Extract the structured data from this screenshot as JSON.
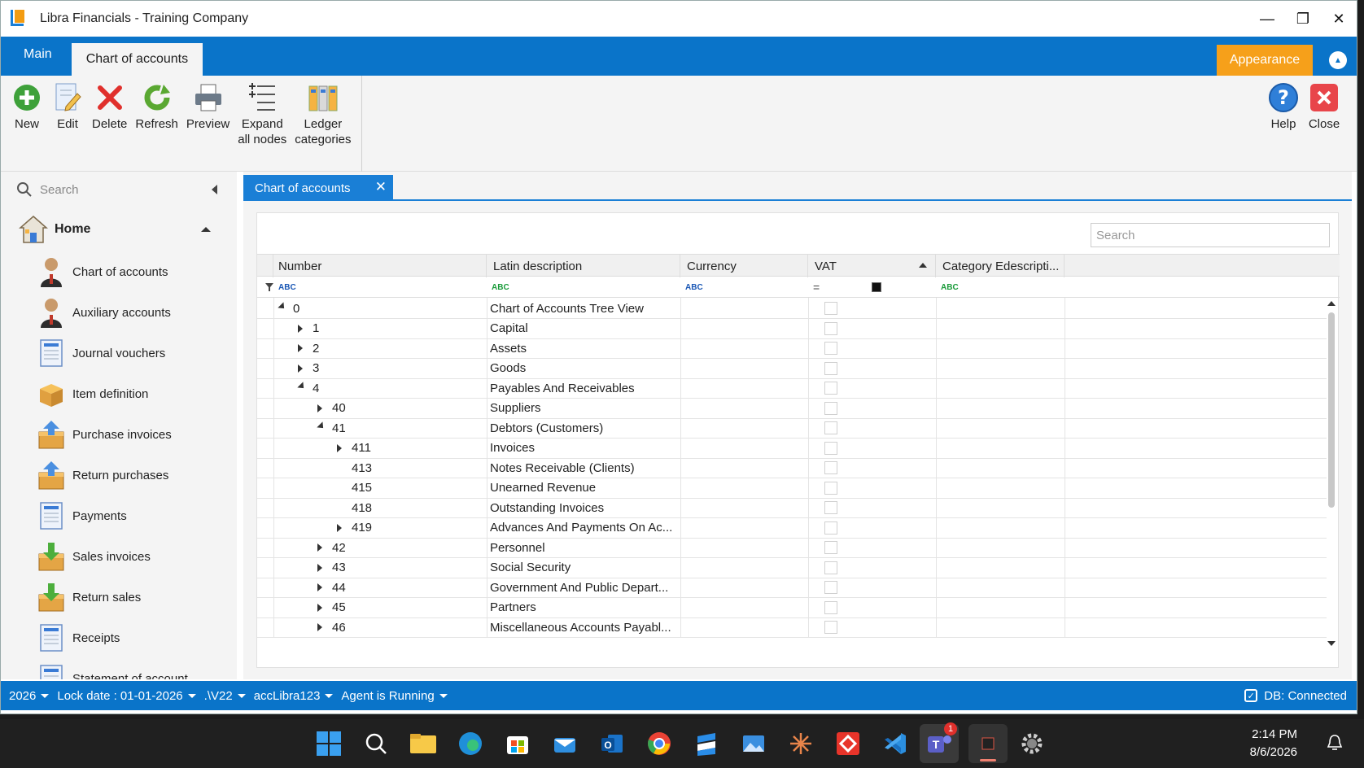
{
  "window": {
    "title": "Libra Financials - Training Company"
  },
  "ribbon": {
    "tabs": [
      {
        "label": "Main"
      },
      {
        "label": "Chart of accounts"
      }
    ],
    "appearance": "Appearance",
    "buttons": [
      {
        "label": "New",
        "icon": "plus-circle-icon"
      },
      {
        "label": "Edit",
        "icon": "edit-document-icon"
      },
      {
        "label": "Delete",
        "icon": "delete-x-icon"
      },
      {
        "label": "Refresh",
        "icon": "refresh-icon"
      },
      {
        "label": "Preview",
        "icon": "printer-icon"
      },
      {
        "label": "Expand all nodes",
        "line1": "Expand",
        "line2": "all nodes",
        "icon": "expand-nodes-icon"
      },
      {
        "label": "Ledger categories",
        "line1": "Ledger",
        "line2": "categories",
        "icon": "ledger-icon"
      }
    ],
    "right_buttons": [
      {
        "label": "Help",
        "icon": "help-icon"
      },
      {
        "label": "Close",
        "icon": "close-icon"
      }
    ]
  },
  "sidebar": {
    "search_placeholder": "Search",
    "home": "Home",
    "items": [
      {
        "label": "Chart of accounts",
        "icon": "person-icon"
      },
      {
        "label": "Auxiliary accounts",
        "icon": "person-icon"
      },
      {
        "label": "Journal vouchers",
        "icon": "document-icon"
      },
      {
        "label": "Item definition",
        "icon": "boxes-icon"
      },
      {
        "label": "Purchase invoices",
        "icon": "box-up-icon"
      },
      {
        "label": "Return purchases",
        "icon": "box-up-icon"
      },
      {
        "label": "Payments",
        "icon": "document-icon"
      },
      {
        "label": "Sales invoices",
        "icon": "box-down-icon"
      },
      {
        "label": "Return sales",
        "icon": "box-down-icon"
      },
      {
        "label": "Receipts",
        "icon": "document-icon"
      },
      {
        "label": "Statement of account",
        "icon": "document-icon"
      }
    ]
  },
  "document_tab": {
    "label": "Chart of accounts"
  },
  "grid": {
    "search_placeholder": "Search",
    "columns": [
      "Number",
      "Latin description",
      "Currency",
      "VAT",
      "Category Edescripti..."
    ],
    "filter_icons": {
      "text": "ABC"
    },
    "rows": [
      {
        "number": "0",
        "description": "Chart of Accounts Tree View",
        "level": 0,
        "expander": "down"
      },
      {
        "number": "1",
        "description": "Capital",
        "level": 1,
        "expander": "right"
      },
      {
        "number": "2",
        "description": "Assets",
        "level": 1,
        "expander": "right"
      },
      {
        "number": "3",
        "description": "Goods",
        "level": 1,
        "expander": "right"
      },
      {
        "number": "4",
        "description": "Payables And Receivables",
        "level": 1,
        "expander": "down"
      },
      {
        "number": "40",
        "description": "Suppliers",
        "level": 2,
        "expander": "right"
      },
      {
        "number": "41",
        "description": "Debtors (Customers)",
        "level": 2,
        "expander": "down"
      },
      {
        "number": "411",
        "description": "Invoices",
        "level": 3,
        "expander": "right"
      },
      {
        "number": "413",
        "description": "Notes Receivable (Clients)",
        "level": 3,
        "expander": ""
      },
      {
        "number": "415",
        "description": "Unearned Revenue",
        "level": 3,
        "expander": ""
      },
      {
        "number": "418",
        "description": "Outstanding Invoices",
        "level": 3,
        "expander": ""
      },
      {
        "number": "419",
        "description": "Advances And Payments On Ac...",
        "level": 3,
        "expander": "right"
      },
      {
        "number": "42",
        "description": "Personnel",
        "level": 2,
        "expander": "right"
      },
      {
        "number": "43",
        "description": "Social Security",
        "level": 2,
        "expander": "right"
      },
      {
        "number": "44",
        "description": "Government And Public Depart...",
        "level": 2,
        "expander": "right"
      },
      {
        "number": "45",
        "description": "Partners",
        "level": 2,
        "expander": "right"
      },
      {
        "number": "46",
        "description": "Miscellaneous Accounts Payabl...",
        "level": 2,
        "expander": "right"
      }
    ]
  },
  "statusbar": {
    "year": "2026",
    "lock_date": "Lock date : 01-01-2026",
    "server": ".\\V22",
    "database": "accLibra123",
    "agent": "Agent is Running",
    "db_status": "DB: Connected"
  },
  "taskbar": {
    "time": "2:14 PM",
    "date": "8/6/2026",
    "teams_badge": "1"
  },
  "colors": {
    "accent": "#0a74c9",
    "appearance": "#f6a01a",
    "tab": "#1a7fd6"
  }
}
